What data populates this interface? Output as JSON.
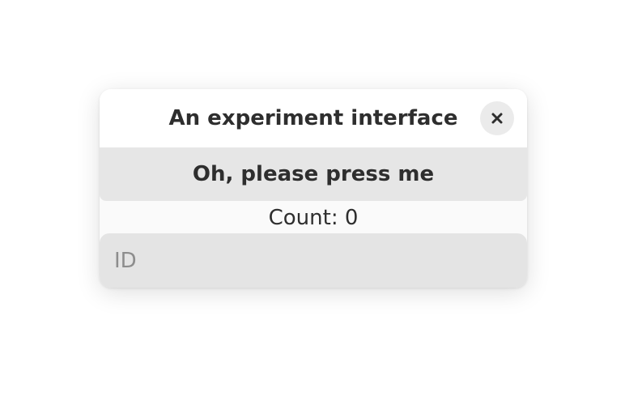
{
  "window": {
    "title": "An experiment interface",
    "close_icon": "close-icon"
  },
  "main": {
    "button_label": "Oh, please press me",
    "count_text": "Count: 0",
    "id_field": {
      "placeholder": "ID",
      "value": ""
    }
  },
  "colors": {
    "window_bg": "#fafafa",
    "titlebar_bg": "#ffffff",
    "button_bg": "#e6e6e6",
    "entry_bg": "#e4e4e4",
    "text": "#2e2e2e",
    "placeholder": "#8d8d8d"
  }
}
